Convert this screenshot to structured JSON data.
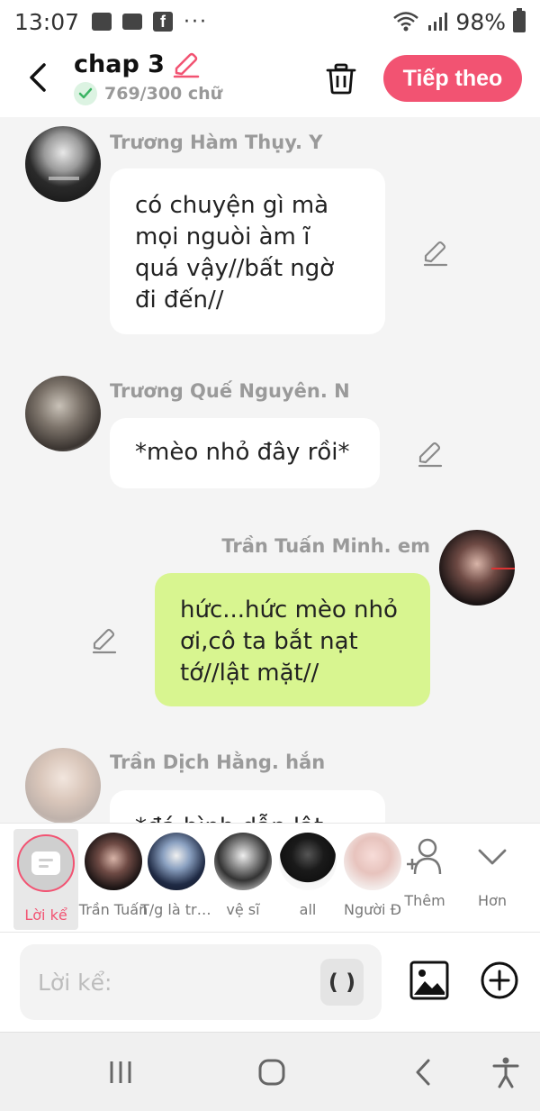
{
  "status_bar": {
    "time": "13:07",
    "more": "···",
    "battery": "98%"
  },
  "header": {
    "title": "chap 3",
    "word_count": "769/300 chữ",
    "next_label": "Tiếp theo"
  },
  "messages": [
    {
      "speaker": "Trương Hàm Thụy. Y",
      "text": "có chuyện gì mà mọi nguòi àm ĩ quá vậy//bất ngờ đi đến//",
      "side": "left"
    },
    {
      "speaker": "Trương Quế Nguyên. N",
      "text": "*mèo nhỏ đây rồi*",
      "side": "left"
    },
    {
      "speaker": "Trần Tuấn Minh. em",
      "text": "hức...hức mèo nhỏ ơi,cô ta bắt nạt tớ//lật mặt//",
      "side": "right"
    },
    {
      "speaker": "Trần Dịch Hằng. hắn",
      "text": "*đá bình dẫn lật",
      "side": "left"
    }
  ],
  "characters": {
    "narrator_label": "Lời kể",
    "items": [
      {
        "label": "Trần Tuấn"
      },
      {
        "label": "T/g là trù..."
      },
      {
        "label": "vệ sĩ"
      },
      {
        "label": "all"
      },
      {
        "label": "Người Đ"
      }
    ],
    "add_label": "Thêm",
    "more_label": "Hơn"
  },
  "input": {
    "placeholder": "Lời kể:",
    "paren_label": "( )"
  },
  "colors": {
    "accent": "#f25372",
    "right_bubble": "#d8f590",
    "background": "#f4f4f4"
  }
}
